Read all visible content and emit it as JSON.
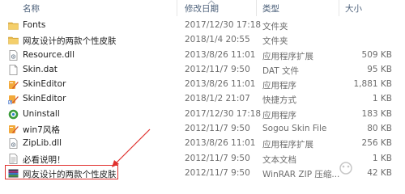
{
  "columns": {
    "name": "名称",
    "date": "修改日期",
    "type": "类型",
    "size": "大小"
  },
  "files": [
    {
      "icon": "folder-icon",
      "name": "Fonts",
      "date": "2017/12/30 17:18",
      "type": "文件夹",
      "size": ""
    },
    {
      "icon": "folder-icon",
      "name": "网友设计的两款个性皮肤",
      "date": "2018/1/4 20:55",
      "type": "文件夹",
      "size": ""
    },
    {
      "icon": "dll-file-icon",
      "name": "Resource.dll",
      "date": "2013/8/26 11:01",
      "type": "应用程序扩展",
      "size": "509 KB"
    },
    {
      "icon": "dat-file-icon",
      "name": "Skin.dat",
      "date": "2012/11/7 9:50",
      "type": "DAT 文件",
      "size": "95 KB"
    },
    {
      "icon": "skin-editor-icon",
      "name": "SkinEditor",
      "date": "2013/8/26 11:01",
      "type": "应用程序",
      "size": "1,881 KB"
    },
    {
      "icon": "skin-editor-icon",
      "name": "SkinEditor",
      "date": "2018/1/2 21:07",
      "type": "快捷方式",
      "size": "1 KB"
    },
    {
      "icon": "uninstall-icon",
      "name": "Uninstall",
      "date": "2017/12/30 17:18",
      "type": "应用程序",
      "size": "183 KB"
    },
    {
      "icon": "sogou-skin-icon",
      "name": "win7风格",
      "date": "2012/11/7 9:50",
      "type": "Sogou Skin File",
      "size": "80 KB"
    },
    {
      "icon": "dll-file-icon",
      "name": "ZipLib.dll",
      "date": "2013/8/26 11:01",
      "type": "应用程序扩展",
      "size": "256 KB"
    },
    {
      "icon": "text-file-icon",
      "name": "必看说明！",
      "date": "2012/11/7 9:50",
      "type": "文本文档",
      "size": "1 KB"
    },
    {
      "icon": "winrar-archive-icon",
      "name": "网友设计的两款个性皮肤",
      "date": "2012/11/7 9:50",
      "type": "WinRAR ZIP 压缩...",
      "size": "42 KB"
    }
  ],
  "colors": {
    "highlight_border": "#e0302d",
    "header_text": "#4c607a",
    "folder": "#e8b94a"
  }
}
